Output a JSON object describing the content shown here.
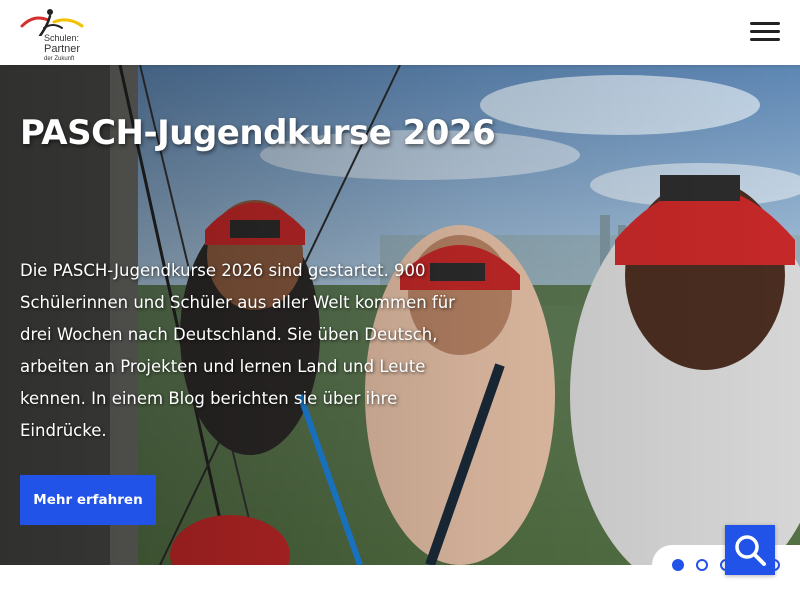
{
  "header": {
    "logo": {
      "line1": "Schulen:",
      "line2": "Partner",
      "line3": "der Zukunft",
      "icon": "pasch-logo-figure",
      "colors": [
        "#d32f2f",
        "#f2c200",
        "#222222"
      ]
    },
    "menu_icon": "hamburger-menu-icon"
  },
  "hero": {
    "title": "PASCH-Jugendkurse 2026",
    "text": "Die PASCH-Jugendkurse 2026 sind gestartet.  900 Schülerinnen und Schüler aus aller Welt kommen für drei Wochen nach Deutschland. Sie üben Deutsch, arbeiten an Projekten und lernen Land und Leute kennen. In einem Blog berichten sie über ihre Eindrücke.",
    "cta_label": "Mehr erfahren",
    "image_subject": "photo-students-climbing-park-helmets"
  },
  "carousel": {
    "slides": 5,
    "active_index": 0
  },
  "search": {
    "icon": "search-icon"
  },
  "colors": {
    "accent": "#2253e8",
    "text_on_image": "#ffffff"
  }
}
